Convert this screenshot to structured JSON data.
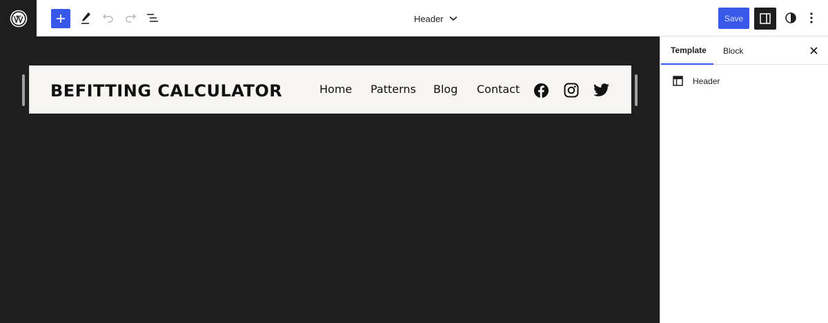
{
  "toolbar": {
    "logo_icon": "wordpress-icon",
    "add_icon": "plus-icon",
    "tools_icon": "pencil-icon",
    "undo_icon": "undo-icon",
    "redo_icon": "redo-icon",
    "list_view_icon": "list-view-icon",
    "document_title": "Header",
    "save_label": "Save",
    "settings_icon": "sidebar-icon",
    "styles_icon": "contrast-icon",
    "options_icon": "more-vertical-icon",
    "accent_color": "#3858e9"
  },
  "canvas": {
    "site_title": "BEFITTING CALCULATOR",
    "nav": [
      "Home",
      "Patterns",
      "Blog",
      "Contact"
    ],
    "social_icons": [
      "facebook-icon",
      "instagram-icon",
      "twitter-icon"
    ],
    "background": "#1e1e1e",
    "header_background": "#f7f5f2"
  },
  "sidebar": {
    "tabs": [
      "Template",
      "Block"
    ],
    "active_tab": "Template",
    "close_icon": "close-icon",
    "template_icon": "layout-icon",
    "template_name": "Header"
  }
}
